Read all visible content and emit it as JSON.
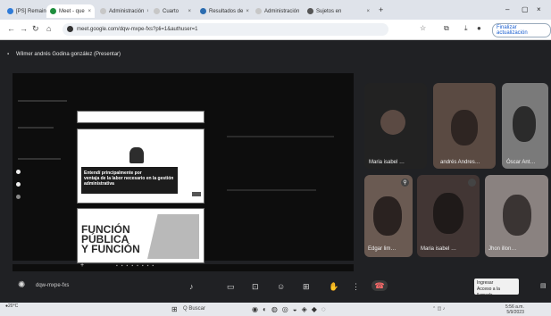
{
  "tabs": [
    {
      "label": "[PS] Remainder",
      "fav": "#2f7bd8",
      "active": false
    },
    {
      "label": "Meet - que",
      "fav": "#1e8e3e",
      "active": true
    },
    {
      "label": "Administración",
      "fav": "#c7c7c7",
      "active": false
    },
    {
      "label": "Cuarto",
      "fav": "#c7c7c7",
      "active": false
    },
    {
      "label": "Resultados de",
      "fav": "#2b6cb0",
      "active": false
    },
    {
      "label": "Administración",
      "fav": "#c7c7c7",
      "active": false
    },
    {
      "label": "Sujetos en",
      "fav": "#555555",
      "active": false
    }
  ],
  "window_controls": [
    "–",
    "▢",
    "×"
  ],
  "address": {
    "url": "meet.google.com/dqw-mxpe-fxs?pli=1&authuser=1",
    "profile_label": "Finalizar actualización"
  },
  "meet": {
    "presenter_label": "Wilmer andrés Godina gonzález (Presentar)",
    "slides": [
      {
        "caption": "",
        "big_text": ""
      },
      {
        "caption": "Entendí principalmente por\nventaja de la labor necesario en la gestión administrativa",
        "big_text": ""
      },
      {
        "caption": "",
        "big_text": "FUNCIÓN\nPÚBLICA\nY FUNCIÓN"
      }
    ],
    "participants": [
      {
        "name": "Maria isabel …",
        "mic": ""
      },
      {
        "name": "andrés Andres…",
        "mic": ""
      },
      {
        "name": "Óscar Ant…",
        "mic": ""
      },
      {
        "name": "Edgar lim…",
        "mic": "⚲"
      },
      {
        "name": "Maria isabel …",
        "mic": ""
      },
      {
        "name": "Jhon illon…",
        "mic": ""
      }
    ],
    "meeting_code": "dqw-mxpe-fxs",
    "notification": {
      "title": "Ingresar",
      "body": "Acceso a la llamada"
    }
  },
  "taskbar": {
    "weather": "20°C",
    "search_label": "Q Buscar",
    "time": "5:56 a.m.",
    "date": "5/9/2023"
  },
  "colors": {
    "meet_bg": "#202124",
    "tab_bar": "#dfe3ea",
    "end_call": "#ea4335"
  }
}
